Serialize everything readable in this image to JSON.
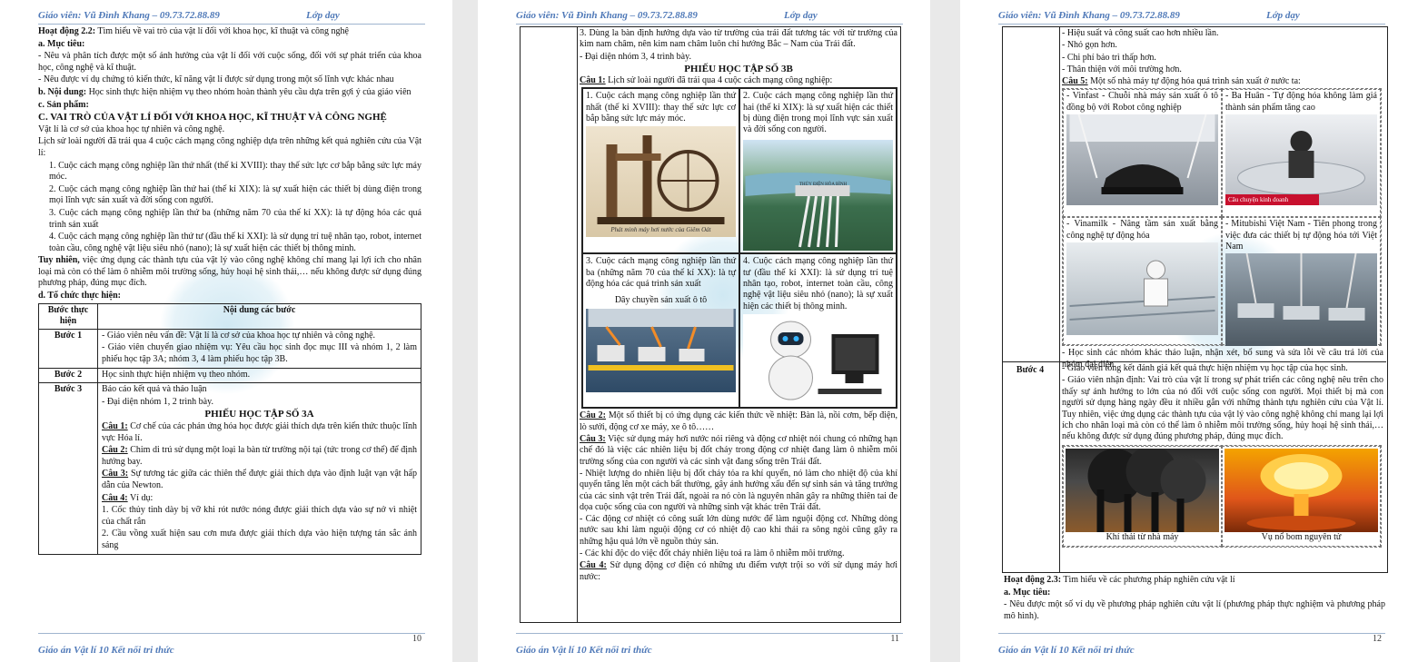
{
  "header": {
    "teacher": "Giáo viên: Vũ Đình Khang – 09.73.72.88.89",
    "center": "Lớp dạy"
  },
  "footer": {
    "title": "Giáo án Vật lí 10 Kết nối tri thức"
  },
  "page1": {
    "number": "10",
    "activity_label": "Hoạt động 2.2:",
    "activity_text": " Tìm hiểu về vai trò của vật lí đối với khoa học, kĩ thuật và công nghệ",
    "goal_label": "a. Mục tiêu:",
    "goal1": "- Nêu và phân tích được một số ảnh hưởng của vật lí đối với cuộc sống, đối với sự phát triển của khoa học, công nghệ và kĩ thuật.",
    "goal2": "- Nêu được ví dụ chứng tỏ kiến thức, kĩ năng vật lí được sử dụng trong một số lĩnh vực khác nhau",
    "content_label": "b. Nội dung:",
    "content_text": " Học sinh thực hiện nhiệm vụ theo nhóm hoàn thành yêu cầu dựa trên gợi ý của giáo viên",
    "product_label": "c. Sản phẩm:",
    "section_title": "C. VAI TRÒ CỦA VẬT LÍ ĐỐI VỚI KHOA HỌC, KĨ THUẬT VÀ CÔNG NGHỆ",
    "p1": "Vật lí là cơ sở của khoa học tự nhiên và công nghệ.",
    "p2": "Lịch sử loài người đã trải qua 4 cuộc cách mạng công nghiệp dựa trên những kết quả nghiên cứu của Vật lí:",
    "r1": "1. Cuộc cách mạng công nghiệp lần thứ nhất (thế kỉ XVIII): thay thế sức lực cơ bắp bằng sức lực máy móc.",
    "r2": "2. Cuộc cách mạng công nghiệp lần thứ hai (thế kỉ XIX): là sự xuất hiện các thiết bị dùng điện trong mọi lĩnh vực sản xuất và đời sống con người.",
    "r3": "3. Cuộc cách mạng công nghiệp lần thứ ba (những năm 70 của thế kỉ XX): là tự động hóa các quá trình sản xuất",
    "r4": "4. Cuộc cách mạng công nghiệp lần thứ tư (đầu thế kỉ XXI): là sử dụng trí tuệ nhân tạo, robot, internet toàn cầu, công nghệ vật liệu siêu nhỏ (nano); là sự xuất hiện các thiết bị thông minh.",
    "however_label": "Tuy nhiên,",
    "however_text": " việc ứng dụng các thành tựu của vật lý vào công nghệ không chỉ mang lại lợi ích cho nhân loại mà còn có thể làm ô nhiễm môi trường sống, hủy hoại hệ sinh thái,… nếu không được sử dụng đúng phương pháp, đúng mục đích.",
    "org_label": "d. Tổ chức thực hiện:",
    "th_step": "Bước thực hiện",
    "th_content": "Nội dung các bước",
    "s1": "Bước 1",
    "s1a": "- Giáo viên nêu vấn đề: Vật lí là cơ sở của khoa học tự nhiên và công nghệ.",
    "s1b": "- Giáo viên chuyển giao nhiệm vụ: Yêu cầu học sinh đọc mục III và nhóm 1, 2 làm phiếu học tập 3A; nhóm 3, 4 làm phiếu học tập 3B.",
    "s2": "Bước 2",
    "s2a": "Học sinh thực hiện nhiệm vụ theo nhóm.",
    "s3": "Bước 3",
    "s3a": "Báo cáo kết quả và thảo luận",
    "s3b": "- Đại diện nhóm 1, 2 trình bày.",
    "sheet3a": "PHIẾU HỌC TẬP SỐ 3A",
    "q1_label": "Câu 1:",
    "q1": " Cơ chế của các phản ứng hóa học được giải thích dựa trên kiến thức thuộc lĩnh vực Hóa lí.",
    "q2_label": "Câu 2:",
    "q2": " Chim di trú sử dụng một loại la bàn từ trường nội tại (tức trong cơ thể) để định hướng bay.",
    "q3_label": "Câu 3:",
    "q3": " Sự tương tác giữa các thiên thể được giải thích dựa vào định luật vạn vật hấp dẫn của Newton.",
    "q4_label": "Câu 4:",
    "q4": " Ví dụ:",
    "q4a": "1. Cốc thủy tinh dày bị vỡ khi rót nước nóng được giải thích dựa vào sự nở vì nhiệt của chất rắn",
    "q4b": "2. Cầu vồng xuất hiện sau cơn mưa được giải thích dựa vào hiện tượng tán sắc ánh sáng"
  },
  "page2": {
    "number": "11",
    "a3": "3. Dùng la bàn định hướng dựa vào từ trường của trái đất tương tác với từ trường của kim nam châm, nên kim nam châm luôn chỉ hướng Bắc – Nam của Trái đất.",
    "rep34": "- Đại diện nhóm 3, 4 trình bày.",
    "sheet3b": "PHIẾU HỌC TẬP SỐ 3B",
    "c1_label": "Câu 1:",
    "c1": " Lịch sử loài người đã trải qua 4 cuộc cách mạng công nghiệp:",
    "g1": "1. Cuộc cách mạng công nghiệp lần thứ nhất (thế kỉ XVIII): thay thế sức lực cơ bắp bằng sức lực máy móc.",
    "g1cap": "Phát minh máy hơi nước của Giêm Oát",
    "g2": "2. Cuộc cách mạng công nghiệp lần thứ hai (thế kỉ XIX): là sự xuất hiện các thiết bị dùng điện trong mọi lĩnh vực sản xuất và đời sống con người.",
    "g2tag": "THỦY ĐIỆN HÒA BÌNH",
    "g3": "3. Cuộc cách mạng công nghiệp lần thứ ba (những năm 70 của thế kỉ XX): là tự động hóa các quá trình sản xuất",
    "g3cap": "Dây chuyền sản xuất ô tô",
    "g4": "4. Cuộc cách mạng công nghiệp lần thứ tư (đầu thế kỉ XXI): là sử dụng trí tuệ nhân tạo, robot, internet toàn cầu, công nghệ vật liệu siêu nhỏ (nano); là sự xuất hiện các thiết bị thông minh.",
    "c2_label": "Câu 2:",
    "c2": " Một số thiết bị có ứng dụng các kiến thức về nhiệt: Bàn là, nồi cơm, bếp điện, lò sưởi, động cơ xe máy, xe ô tô……",
    "c3_label": "Câu 3:",
    "c3": " Việc sử dụng máy hơi nước nói riêng và động cơ nhiệt nói chung có những hạn chế đó là việc các nhiên liệu bị đốt cháy trong động cơ nhiệt đang làm ô nhiễm môi trường sống của con người và các sinh vật đang sống trên Trái đất.",
    "c3a": "- Nhiệt lượng do nhiên liệu bị đốt cháy tỏa ra khí quyển, nó làm cho nhiệt độ của khí quyển tăng lên một cách bất thường, gây ảnh hưởng xấu đến sự sinh sản và tăng trưởng của các sinh vật trên Trái đất, ngoài ra nó còn là nguyên nhân gây ra những thiên tai đe dọa cuộc sống của con người và những sinh vật khác trên Trái đất.",
    "c3b": "- Các động cơ nhiệt có công suất lớn dùng nước để làm nguội động cơ. Những dòng nước sau khi làm nguội động cơ có nhiệt độ cao khi thải ra sông ngòi cũng gây ra những hậu quả lớn về nguồn thủy sản.",
    "c3c": "- Các khí độc do việc đốt cháy nhiên liệu toả ra làm ô nhiễm môi trường.",
    "c4_label": "Câu 4:",
    "c4": " Sử dụng động cơ điện có những ưu điểm vượt trội so với sử dụng máy hơi nước:"
  },
  "page3": {
    "number": "12",
    "b1": "- Hiệu suất và công suất cao hơn nhiều lần.",
    "b2": "- Nhỏ gọn hơn.",
    "b3": "- Chi phí bảo trì thấp hơn.",
    "b4": "- Thân thiện với môi trường hơn.",
    "c5_label": "Câu 5:",
    "c5": " Một số nhà máy tự động hóa quá trình sản xuất ở nước ta:",
    "f1": "- Vinfast - Chuỗi nhà máy sản xuất ô tô đồng bộ với Robot công nghiệp",
    "f2": "- Ba Huân - Tự động hóa không làm giá thành sản phẩm tăng cao",
    "f2tag": "Câu chuyện kinh doanh",
    "f3": "- Vinamilk - Nâng tầm sản xuất bằng công nghệ tự động hóa",
    "f4": "- Mitubishi Việt Nam - Tiên phong trong việc đưa các thiết bị tự động hóa tới Việt Nam",
    "disc": "- Học sinh các nhóm khác thảo luận, nhận xét, bổ sung và sửa lỗi về câu trả lời của nhóm đại diện.",
    "s4": "Bước 4",
    "s4a": "- Giáo viên tổng kết đánh giá kết quả thực hiện nhiệm vụ học tập của học sinh.",
    "s4b": "- Giáo viên nhận định: Vai trò của vật lí trong sự phát triển các công nghệ nêu trên cho thấy sự ảnh hưởng to lớn của nó đối với cuộc sống con người. Mọi thiết bị mà con người sử dụng hàng ngày đều ít nhiều gắn với những thành tựu nghiên cứu của Vật lí. Tuy nhiên, việc ứng dụng các thành tựu của vật lý vào công nghệ không chỉ mang lại lợi ích cho nhân loại mà còn có thể làm ô nhiễm môi trường sống, hủy hoại hệ sinh thái,… nếu không được sử dụng đúng phương pháp, đúng mục đích.",
    "cap1": "Khí thải từ nhà máy",
    "cap2": "Vụ nổ bom nguyên tử",
    "act23_label": "Hoạt động 2.3:",
    "act23": " Tìm hiểu về các phương pháp nghiên cứu vật lí",
    "goal_label": "a. Mục tiêu:",
    "goal": "- Nêu được một số ví dụ về phương pháp nghiên cứu vật lí (phương pháp thực nghiệm và phương pháp mô hình)."
  }
}
